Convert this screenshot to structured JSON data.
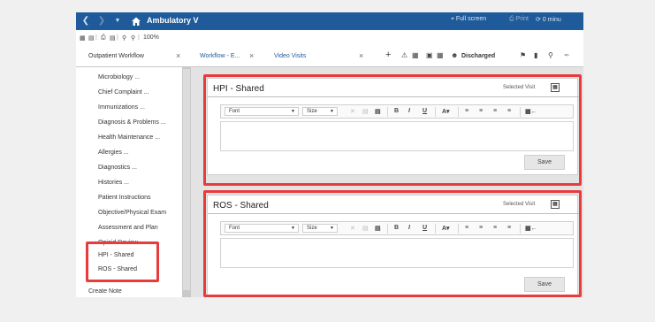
{
  "titlebar": {
    "title": "Ambulatory V",
    "full_screen": "Full screen",
    "print": "Print",
    "refresh": "0 minu"
  },
  "toolbar": {
    "zoom": "100%"
  },
  "tabs": {
    "outpatient": "Outpatient Workflow",
    "workflow": "Workflow - E...",
    "video": "Video Visits",
    "discharged": "Discharged"
  },
  "sidebar": {
    "items": [
      "Microbiology ...",
      "Chief Complaint ...",
      "Immunizations ...",
      "Diagnosis & Problems ...",
      "Health Maintenance ...",
      "Allergies ...",
      "Diagnostics ...",
      "Histories ...",
      "Patient Instructions",
      "Objective/Physical Exam",
      "Assessment and Plan",
      "Opioid Review ...",
      "HPI - Shared",
      "ROS - Shared",
      "Create Note"
    ]
  },
  "panels": [
    {
      "title": "HPI - Shared",
      "selected_visit": "Selected Visit",
      "font_label": "Font",
      "size_label": "Size",
      "save_label": "Save"
    },
    {
      "title": "ROS - Shared",
      "selected_visit": "Selected Visit",
      "font_label": "Font",
      "size_label": "Size",
      "save_label": "Save"
    }
  ],
  "colors": {
    "titlebar": "#1f5a9a",
    "highlight": "#e83b3b",
    "tab_link": "#1f5a9a"
  }
}
